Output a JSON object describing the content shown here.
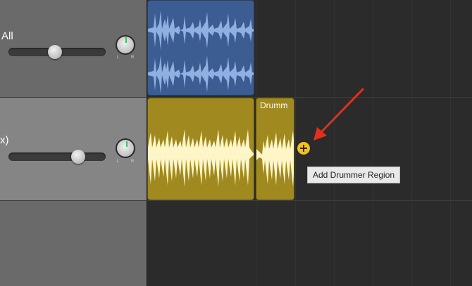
{
  "tracks": [
    {
      "name": "All",
      "pan_labels": {
        "left": "L",
        "right": "R"
      }
    },
    {
      "name": "x)",
      "pan_labels": {
        "left": "L",
        "right": "R"
      }
    }
  ],
  "regions": {
    "drummer_region_title": "Drumm"
  },
  "tooltip": {
    "text": "Add Drummer Region"
  },
  "colors": {
    "audio_region": "#3b5d92",
    "drummer_region": "#a08a1f",
    "add_button": "#f2c21a",
    "arrow": "#e0301e"
  }
}
